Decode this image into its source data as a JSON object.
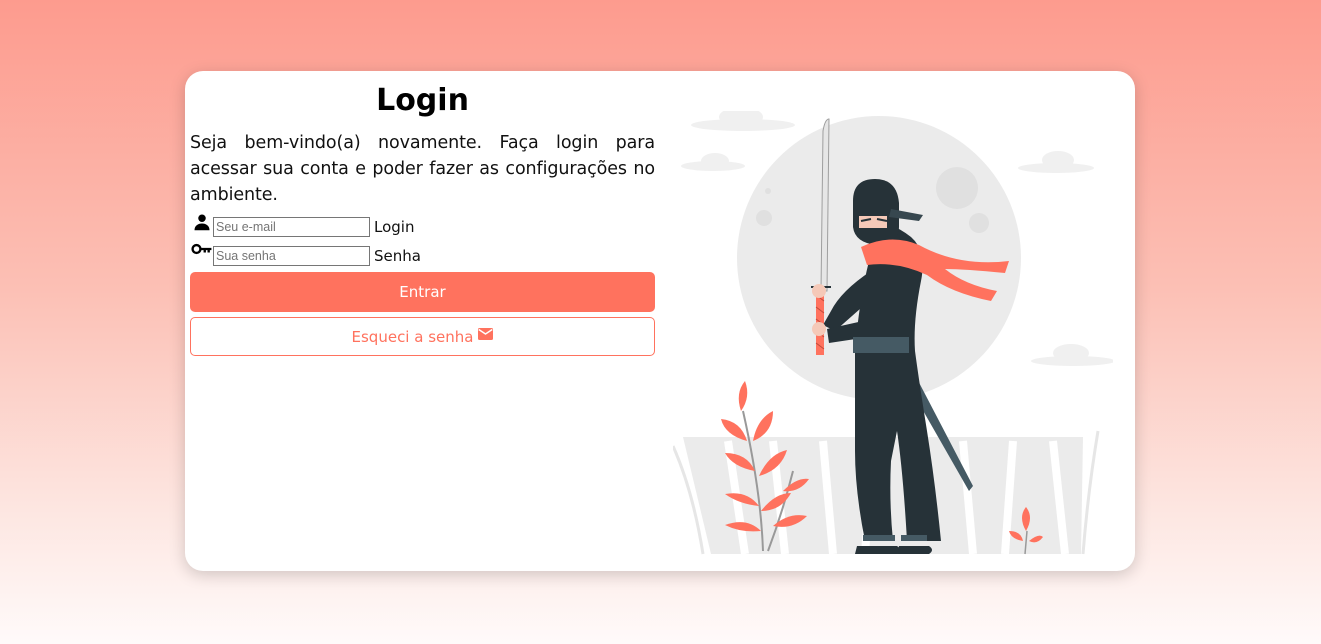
{
  "login": {
    "title": "Login",
    "subtitle": "Seja bem-vindo(a) novamente. Faça login para acessar sua conta e poder fazer as configurações no ambiente.",
    "email": {
      "placeholder": "Seu e-mail",
      "value": "",
      "label": "Login",
      "icon": "user-icon"
    },
    "password": {
      "placeholder": "Sua senha",
      "value": "",
      "label": "Senha",
      "icon": "key-icon"
    },
    "submit_label": "Entrar",
    "forgot_label": "Esqueci a senha",
    "forgot_icon": "mail-icon"
  },
  "colors": {
    "accent": "#ff725e",
    "ninja_dark": "#263238",
    "moon": "#ebebeb"
  }
}
